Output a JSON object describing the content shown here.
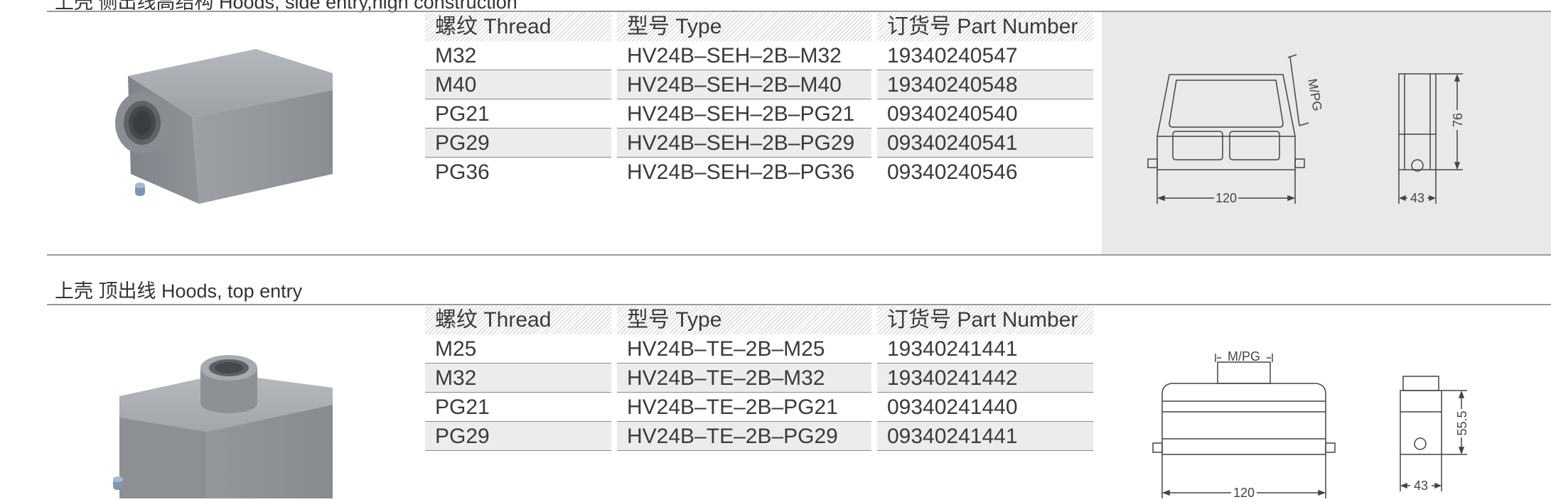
{
  "section1": {
    "title": "上壳 侧出线高结构 Hoods, side entry,high construction",
    "table": {
      "headers": [
        "螺纹 Thread",
        "型号 Type",
        "订货号 Part Number"
      ],
      "rows": [
        {
          "thread": "M32",
          "type": "HV24B–SEH–2B–M32",
          "part": "19340240547"
        },
        {
          "thread": "M40",
          "type": "HV24B–SEH–2B–M40",
          "part": "19340240548"
        },
        {
          "thread": "PG21",
          "type": "HV24B–SEH–2B–PG21",
          "part": "09340240540"
        },
        {
          "thread": "PG29",
          "type": "HV24B–SEH–2B–PG29",
          "part": "09340240541"
        },
        {
          "thread": "PG36",
          "type": "HV24B–SEH–2B–PG36",
          "part": "09340240546"
        }
      ]
    },
    "drawing": {
      "width_label": "120",
      "depth_label": "43",
      "height_label": "76",
      "thread_label": "M/PG"
    }
  },
  "section2": {
    "title": "上壳 顶出线  Hoods, top  entry",
    "table": {
      "headers": [
        "螺纹 Thread",
        "型号 Type",
        "订货号 Part Number"
      ],
      "rows": [
        {
          "thread": "M25",
          "type": "HV24B–TE–2B–M25",
          "part": "19340241441"
        },
        {
          "thread": "M32",
          "type": "HV24B–TE–2B–M32",
          "part": "19340241442"
        },
        {
          "thread": "PG21",
          "type": "HV24B–TE–2B–PG21",
          "part": "09340241440"
        },
        {
          "thread": "PG29",
          "type": "HV24B–TE–2B–PG29",
          "part": "09340241441"
        }
      ]
    },
    "drawing": {
      "width_label": "120",
      "depth_label": "43",
      "height_label": "55.5",
      "thread_label": "M/PG"
    }
  },
  "colors": {
    "panel": "#e9e9e9",
    "rule": "#9a9a9a",
    "housing": "#8e9297"
  }
}
